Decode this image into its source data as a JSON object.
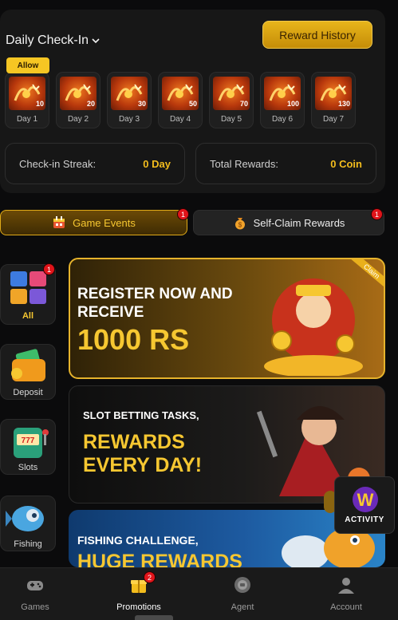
{
  "checkin": {
    "title": "Daily Check-In",
    "reward_history_label": "Reward History",
    "allow_label": "Allow",
    "days": [
      {
        "label": "Day 1",
        "amount": "10"
      },
      {
        "label": "Day 2",
        "amount": "20"
      },
      {
        "label": "Day 3",
        "amount": "30"
      },
      {
        "label": "Day 4",
        "amount": "50"
      },
      {
        "label": "Day 5",
        "amount": "70"
      },
      {
        "label": "Day 6",
        "amount": "100"
      },
      {
        "label": "Day 7",
        "amount": "130"
      }
    ],
    "streak_label": "Check-in Streak:",
    "streak_value": "0 Day",
    "total_label": "Total Rewards:",
    "total_value": "0 Coin"
  },
  "tabs": {
    "game_events": {
      "label": "Game Events",
      "badge": "1"
    },
    "self_claim": {
      "label": "Self-Claim Rewards",
      "badge": "1"
    }
  },
  "categories": [
    {
      "label": "All",
      "badge": "1",
      "icon": "cube-icon"
    },
    {
      "label": "Deposit",
      "icon": "wallet-icon"
    },
    {
      "label": "Slots",
      "icon": "slot-machine-icon"
    },
    {
      "label": "Fishing",
      "icon": "fish-icon"
    }
  ],
  "banners": {
    "register": {
      "line1": "REGISTER NOW AND",
      "line2": "RECEIVE",
      "line3": "1000 RS",
      "ribbon": "Claim"
    },
    "slot": {
      "line1": "SLOT BETTING TASKS,",
      "line2": "REWARDS",
      "line3": "EVERY DAY!"
    },
    "fishing": {
      "line1": "FISHING CHALLENGE,",
      "line2": "HUGE REWARDS"
    }
  },
  "activity": {
    "label": "ACTIVITY",
    "letter": "W"
  },
  "nav": {
    "games": "Games",
    "promotions": "Promotions",
    "promotions_badge": "2",
    "agent": "Agent",
    "account": "Account"
  },
  "colors": {
    "accent": "#f2bc1d",
    "badge": "#e0141a",
    "background": "#0b0b0c"
  }
}
